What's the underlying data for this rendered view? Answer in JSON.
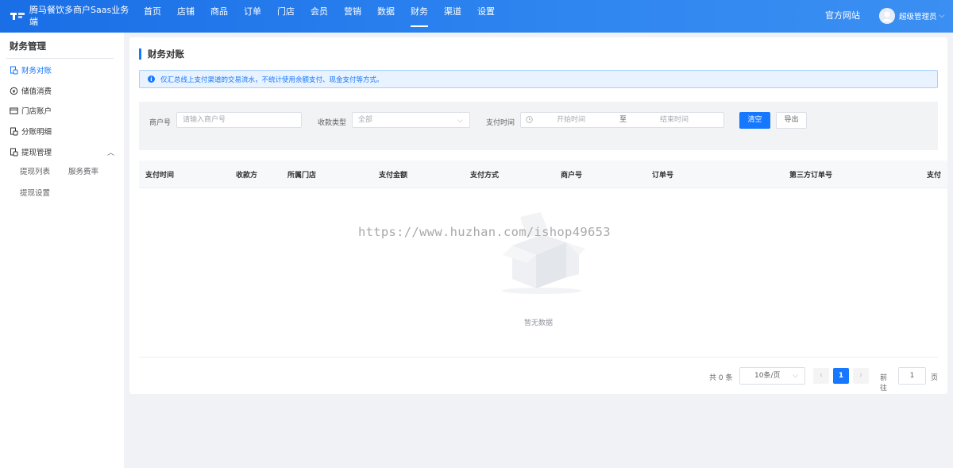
{
  "header": {
    "brand": "腾马餐饮多商户Saas业务端",
    "nav": [
      "首页",
      "店铺",
      "商品",
      "订单",
      "门店",
      "会员",
      "营销",
      "数据",
      "财务",
      "渠道",
      "设置"
    ],
    "active_nav": "财务",
    "official_site": "官方网站",
    "user_name": "超级管理员",
    "user_caret": "⌵"
  },
  "sidebar": {
    "title": "财务管理",
    "items": [
      "财务对账",
      "储值消费",
      "门店账户",
      "分账明细",
      "提现管理"
    ],
    "active_item": "财务对账",
    "withdraw_sub": [
      "提现列表",
      "服务费率",
      "提现设置"
    ]
  },
  "page": {
    "title": "财务对账",
    "alert": "仅汇总线上支付渠道的交易流水，不统计使用余额支付、现金支付等方式。",
    "alert_icon": "i"
  },
  "filter": {
    "merchant_label": "商户号",
    "merchant_placeholder": "请输入商户号",
    "type_label": "收款类型",
    "type_value": "全部",
    "time_label": "支付时间",
    "time_start": "开始时间",
    "time_separator": "至",
    "time_end": "结束时间",
    "clear_button": "清空",
    "export_button": "导出"
  },
  "table": {
    "columns": [
      "支付时间",
      "收款方",
      "所属门店",
      "支付金额",
      "支付方式",
      "商户号",
      "订单号",
      "第三方订单号",
      "支付"
    ],
    "empty_text": "暂无数据"
  },
  "watermark": "https://www.huzhan.com/ishop49653",
  "pagination": {
    "total": "共 0 条",
    "page_size": "10条/页",
    "prev": "‹",
    "current_page": "1",
    "next": "›",
    "goto_label": "前往",
    "goto_value": "1",
    "page_unit": "页"
  },
  "colors": {
    "primary": "#1677ff",
    "header_gradient_start": "#1a6ee6",
    "alert_background": "#e8f3ff"
  }
}
